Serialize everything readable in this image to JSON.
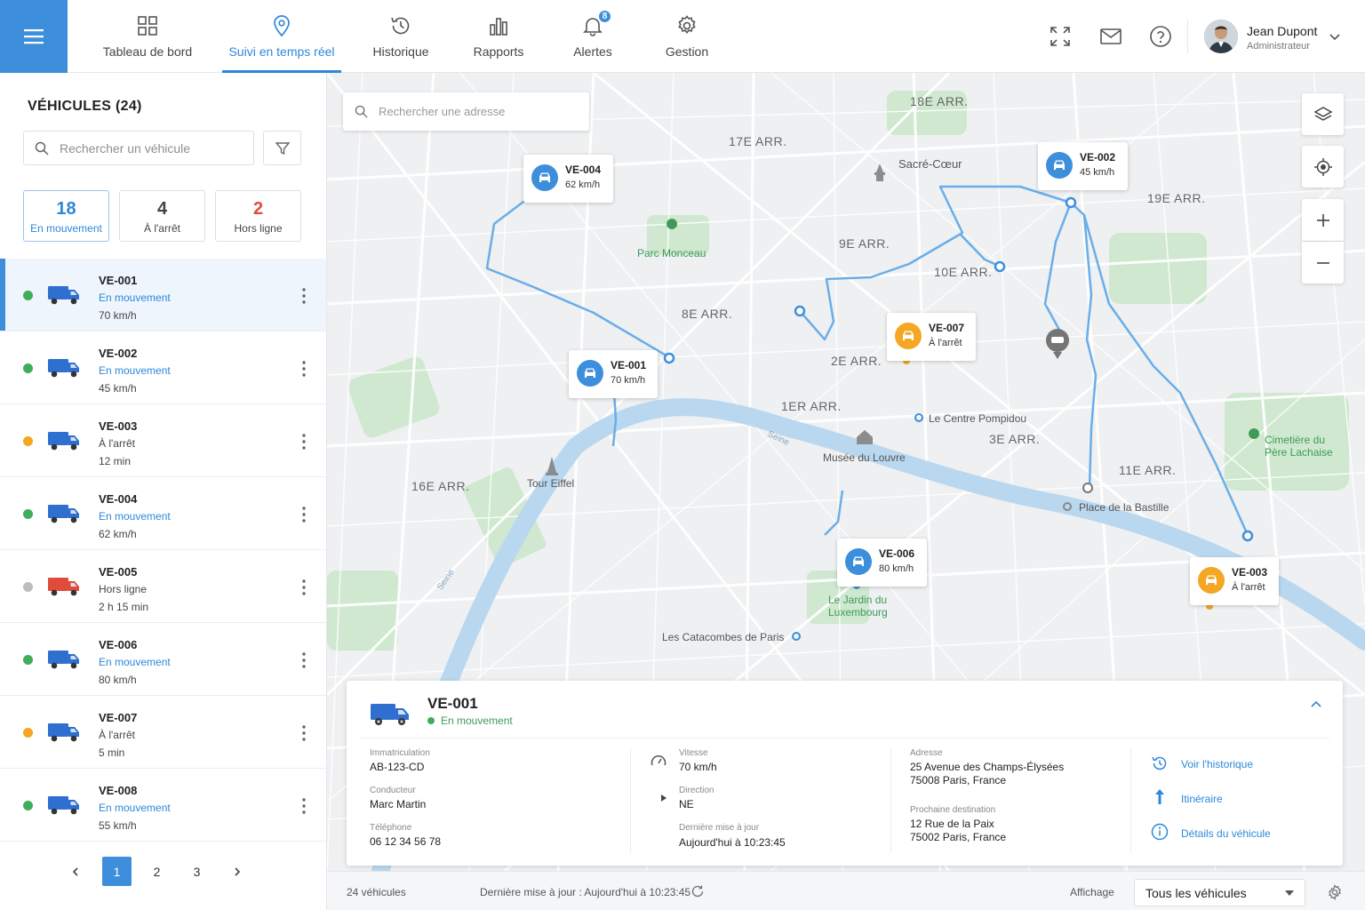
{
  "nav": {
    "tabs": [
      {
        "label": "Tableau de bord",
        "icon": "dashboard-icon"
      },
      {
        "label": "Suivi en temps réel",
        "icon": "location-pin-icon",
        "active": true
      },
      {
        "label": "Historique",
        "icon": "history-icon"
      },
      {
        "label": "Rapports",
        "icon": "bar-chart-icon"
      },
      {
        "label": "Alertes",
        "icon": "bell-icon",
        "badge": "8"
      },
      {
        "label": "Gestion",
        "icon": "gear-icon"
      }
    ],
    "user": {
      "name": "Jean Dupont",
      "role": "Administrateur"
    }
  },
  "sidebar": {
    "title": "VÉHICULES (24)",
    "search_placeholder": "Rechercher un véhicule",
    "stats": [
      {
        "value": "18",
        "label": "En mouvement"
      },
      {
        "value": "4",
        "label": "À l'arrêt"
      },
      {
        "value": "2",
        "label": "Hors ligne"
      }
    ],
    "vehicles": [
      {
        "id": "VE-001",
        "status": "En mouvement",
        "extra": "70 km/h",
        "state": "moving"
      },
      {
        "id": "VE-002",
        "status": "En mouvement",
        "extra": "45 km/h",
        "state": "moving"
      },
      {
        "id": "VE-003",
        "status": "À l'arrêt",
        "extra": "12 min",
        "state": "stopped"
      },
      {
        "id": "VE-004",
        "status": "En mouvement",
        "extra": "62 km/h",
        "state": "moving"
      },
      {
        "id": "VE-005",
        "status": "Hors ligne",
        "extra": "2 h 15 min",
        "state": "offline"
      },
      {
        "id": "VE-006",
        "status": "En mouvement",
        "extra": "80 km/h",
        "state": "moving"
      },
      {
        "id": "VE-007",
        "status": "À l'arrêt",
        "extra": "5 min",
        "state": "stopped"
      },
      {
        "id": "VE-008",
        "status": "En mouvement",
        "extra": "55 km/h",
        "state": "moving"
      }
    ],
    "pages": [
      "1",
      "2",
      "3"
    ]
  },
  "map": {
    "search_placeholder": "Rechercher une adresse",
    "districts": [
      "18E ARR.",
      "17E ARR.",
      "19E ARR.",
      "9E ARR.",
      "10E ARR.",
      "8E ARR.",
      "2E ARR.",
      "1ER ARR.",
      "3E ARR.",
      "11E ARR.",
      "16E ARR."
    ],
    "pois": {
      "sacre_coeur": "Sacré-Cœur",
      "parc_monceau": "Parc Monceau",
      "pompidou": "Le Centre Pompidou",
      "louvre": "Musée du Louvre",
      "eiffel": "Tour Eiffel",
      "pere_lachaise_1": "Cimetière du",
      "pere_lachaise_2": "Père Lachaise",
      "bastille": "Place de la Bastille",
      "luxembourg_1": "Le Jardin du",
      "luxembourg_2": "Luxembourg",
      "catacombes": "Les Catacombes de Paris",
      "seine_1": "Seine",
      "seine_2": "Seine"
    },
    "markers": [
      {
        "id": "VE-004",
        "sub": "62 km/h",
        "state": "moving"
      },
      {
        "id": "VE-002",
        "sub": "45 km/h",
        "state": "moving"
      },
      {
        "id": "VE-007",
        "sub": "À l'arrêt",
        "state": "stopped"
      },
      {
        "id": "VE-001",
        "sub": "70 km/h",
        "state": "moving"
      },
      {
        "id": "VE-006",
        "sub": "80 km/h",
        "state": "moving"
      },
      {
        "id": "VE-003",
        "sub": "À l'arrêt",
        "state": "stopped"
      }
    ]
  },
  "detail": {
    "title": "VE-001",
    "status": "En mouvement",
    "plate_label": "Immatriculation",
    "plate": "AB-123-CD",
    "driver_label": "Conducteur",
    "driver": "Marc Martin",
    "phone_label": "Téléphone",
    "phone": "06 12 34 56 78",
    "speed_label": "Vitesse",
    "speed": "70 km/h",
    "direction_label": "Direction",
    "direction": "NE",
    "update_label": "Dernière mise à jour",
    "update": "Aujourd'hui à 10:23:45",
    "address_label": "Adresse",
    "address_1": "25 Avenue des Champs-Élysées",
    "address_2": "75008 Paris, France",
    "next_label": "Prochaine destination",
    "next_1": "12 Rue de la Paix",
    "next_2": "75002 Paris, France",
    "link_history": "Voir l'historique",
    "link_route": "Itinéraire",
    "link_details": "Détails du véhicule"
  },
  "footer": {
    "count": "24 véhicules",
    "updated": "Dernière mise à jour : Aujourd'hui à 10:23:45",
    "display_label": "Affichage",
    "display_value": "Tous les véhicules"
  },
  "colors": {
    "accent": "#3d8fdb",
    "moving": "#3fae5a",
    "stopped": "#f5a623",
    "offline": "#bdbdbd",
    "offline_truck": "#e04b3c",
    "route": "#6aaee8"
  }
}
